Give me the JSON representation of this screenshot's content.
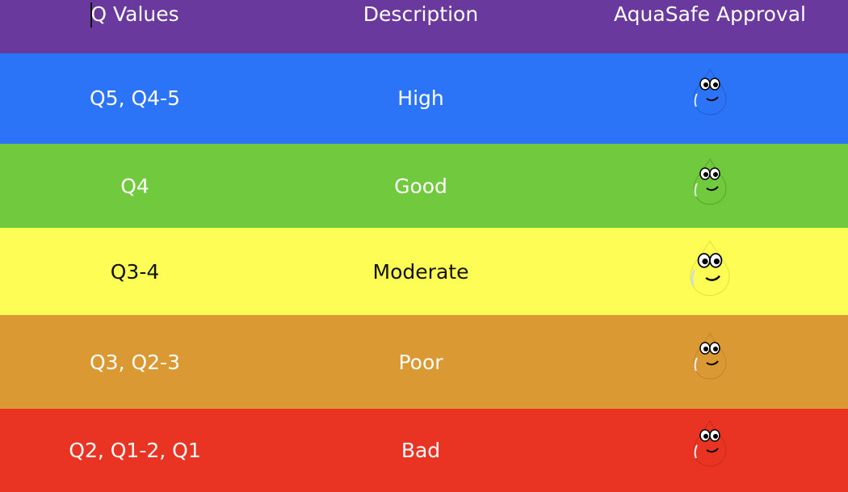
{
  "header": {
    "col_q_values": "Q Values",
    "col_description": "Description",
    "col_approval": "AquaSafe Approval"
  },
  "rows": [
    {
      "q_values": "Q5, Q4-5",
      "description": "High",
      "color": "#2b74f7",
      "approval_icon": "water-drop-face-icon"
    },
    {
      "q_values": "Q4",
      "description": "Good",
      "color": "#71c93e",
      "approval_icon": "water-drop-face-icon"
    },
    {
      "q_values": "Q3-4",
      "description": "Moderate",
      "color": "#fdfd55",
      "approval_icon": "water-drop-face-icon"
    },
    {
      "q_values": "Q3, Q2-3",
      "description": "Poor",
      "color": "#db9933",
      "approval_icon": "water-drop-face-icon"
    },
    {
      "q_values": "Q2, Q1-2, Q1",
      "description": "Bad",
      "color": "#e93424",
      "approval_icon": "water-drop-face-icon"
    }
  ],
  "colors": {
    "header": "#69399d"
  }
}
